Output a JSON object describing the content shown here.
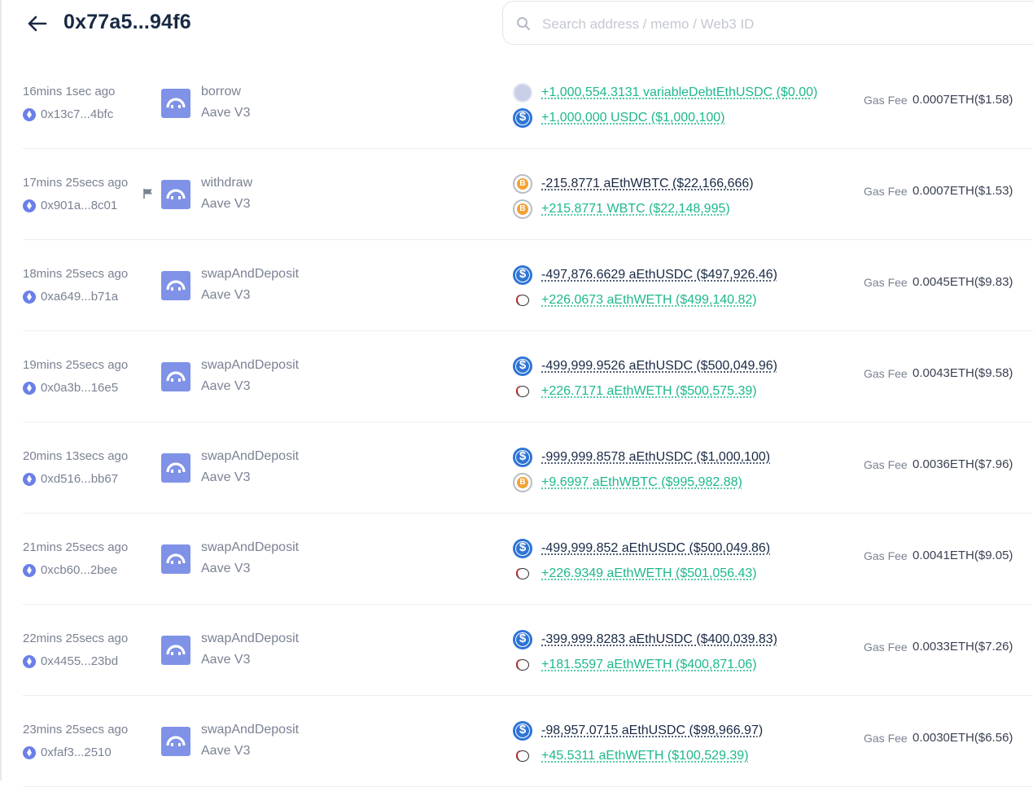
{
  "header": {
    "title": "0x77a5...94f6",
    "search_placeholder": "Search address / memo / Web3 ID"
  },
  "gas_label": "Gas Fee",
  "transactions": [
    {
      "time": "16mins 1sec ago",
      "hash": "0x13c7...4bfc",
      "flag": false,
      "method": "borrow",
      "project": "Aave V3",
      "in_token": "debt",
      "in_amount": "+1,000,554.3131 variableDebtEthUSDC ($0.00)",
      "in_sign": "pos",
      "out_token": "usdc",
      "out_amount": "+1,000,000 USDC ($1,000,100)",
      "out_sign": "pos",
      "gas": "0.0007ETH($1.58)"
    },
    {
      "time": "17mins 25secs ago",
      "hash": "0x901a...8c01",
      "flag": true,
      "method": "withdraw",
      "project": "Aave V3",
      "in_token": "btc",
      "in_amount": "-215.8771 aEthWBTC ($22,166,666)",
      "in_sign": "neg",
      "out_token": "btc",
      "out_amount": "+215.8771 WBTC ($22,148,995)",
      "out_sign": "pos",
      "gas": "0.0007ETH($1.53)"
    },
    {
      "time": "18mins 25secs ago",
      "hash": "0xa649...b71a",
      "flag": false,
      "method": "swapAndDeposit",
      "project": "Aave V3",
      "in_token": "usdc",
      "in_amount": "-497,876.6629 aEthUSDC ($497,926.46)",
      "in_sign": "neg",
      "out_token": "weth",
      "out_amount": "+226.0673 aEthWETH ($499,140.82)",
      "out_sign": "pos",
      "gas": "0.0045ETH($9.83)"
    },
    {
      "time": "19mins 25secs ago",
      "hash": "0x0a3b...16e5",
      "flag": false,
      "method": "swapAndDeposit",
      "project": "Aave V3",
      "in_token": "usdc",
      "in_amount": "-499,999.9526 aEthUSDC ($500,049.96)",
      "in_sign": "neg",
      "out_token": "weth",
      "out_amount": "+226.7171 aEthWETH ($500,575.39)",
      "out_sign": "pos",
      "gas": "0.0043ETH($9.58)"
    },
    {
      "time": "20mins 13secs ago",
      "hash": "0xd516...bb67",
      "flag": false,
      "method": "swapAndDeposit",
      "project": "Aave V3",
      "in_token": "usdc",
      "in_amount": "-999,999.8578 aEthUSDC ($1,000,100)",
      "in_sign": "neg",
      "out_token": "btc",
      "out_amount": "+9.6997 aEthWBTC ($995,982.88)",
      "out_sign": "pos",
      "gas": "0.0036ETH($7.96)"
    },
    {
      "time": "21mins 25secs ago",
      "hash": "0xcb60...2bee",
      "flag": false,
      "method": "swapAndDeposit",
      "project": "Aave V3",
      "in_token": "usdc",
      "in_amount": "-499,999.852 aEthUSDC ($500,049.86)",
      "in_sign": "neg",
      "out_token": "weth",
      "out_amount": "+226.9349 aEthWETH ($501,056.43)",
      "out_sign": "pos",
      "gas": "0.0041ETH($9.05)"
    },
    {
      "time": "22mins 25secs ago",
      "hash": "0x4455...23bd",
      "flag": false,
      "method": "swapAndDeposit",
      "project": "Aave V3",
      "in_token": "usdc",
      "in_amount": "-399,999.8283 aEthUSDC ($400,039.83)",
      "in_sign": "neg",
      "out_token": "weth",
      "out_amount": "+181.5597 aEthWETH ($400,871.06)",
      "out_sign": "pos",
      "gas": "0.0033ETH($7.26)"
    },
    {
      "time": "23mins 25secs ago",
      "hash": "0xfaf3...2510",
      "flag": false,
      "method": "swapAndDeposit",
      "project": "Aave V3",
      "in_token": "usdc",
      "in_amount": "-98,957.0715 aEthUSDC ($98,966.97)",
      "in_sign": "neg",
      "out_token": "weth",
      "out_amount": "+45.5311 aEthWETH ($100,529.39)",
      "out_sign": "pos",
      "gas": "0.0030ETH($6.56)"
    }
  ]
}
